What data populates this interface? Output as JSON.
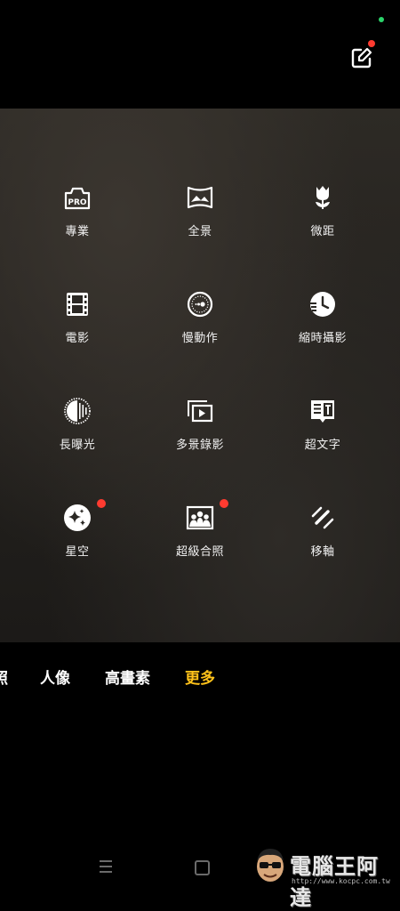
{
  "status": {
    "indicator_color": "#2bd46a"
  },
  "toolbar": {
    "edit_icon": "edit-square-icon",
    "edit_badge_color": "#ff3b30"
  },
  "modes": [
    {
      "label": "專業",
      "icon": "pro-camera-icon",
      "badge": false
    },
    {
      "label": "全景",
      "icon": "panorama-icon",
      "badge": false
    },
    {
      "label": "微距",
      "icon": "tulip-macro-icon",
      "badge": false
    },
    {
      "label": "電影",
      "icon": "film-icon",
      "badge": false
    },
    {
      "label": "慢動作",
      "icon": "slow-motion-icon",
      "badge": false
    },
    {
      "label": "縮時攝影",
      "icon": "timelapse-clock-icon",
      "badge": false
    },
    {
      "label": "長曝光",
      "icon": "long-exposure-icon",
      "badge": false
    },
    {
      "label": "多景錄影",
      "icon": "multi-scene-video-icon",
      "badge": false
    },
    {
      "label": "超文字",
      "icon": "text-scan-icon",
      "badge": false
    },
    {
      "label": "星空",
      "icon": "starry-sky-icon",
      "badge": true
    },
    {
      "label": "超級合照",
      "icon": "group-photo-icon",
      "badge": true
    },
    {
      "label": "移軸",
      "icon": "tilt-shift-icon",
      "badge": false
    }
  ],
  "mode_bar": {
    "partial_label": "照",
    "tabs": [
      "人像",
      "高畫素",
      "更多"
    ],
    "active_tab": "更多",
    "active_color": "#ffc21a"
  },
  "nav": {
    "recents_icon": "recents-icon",
    "home_icon": "home-icon"
  },
  "watermark": {
    "title": "電腦王阿達",
    "url": "http://www.kocpc.com.tw"
  }
}
